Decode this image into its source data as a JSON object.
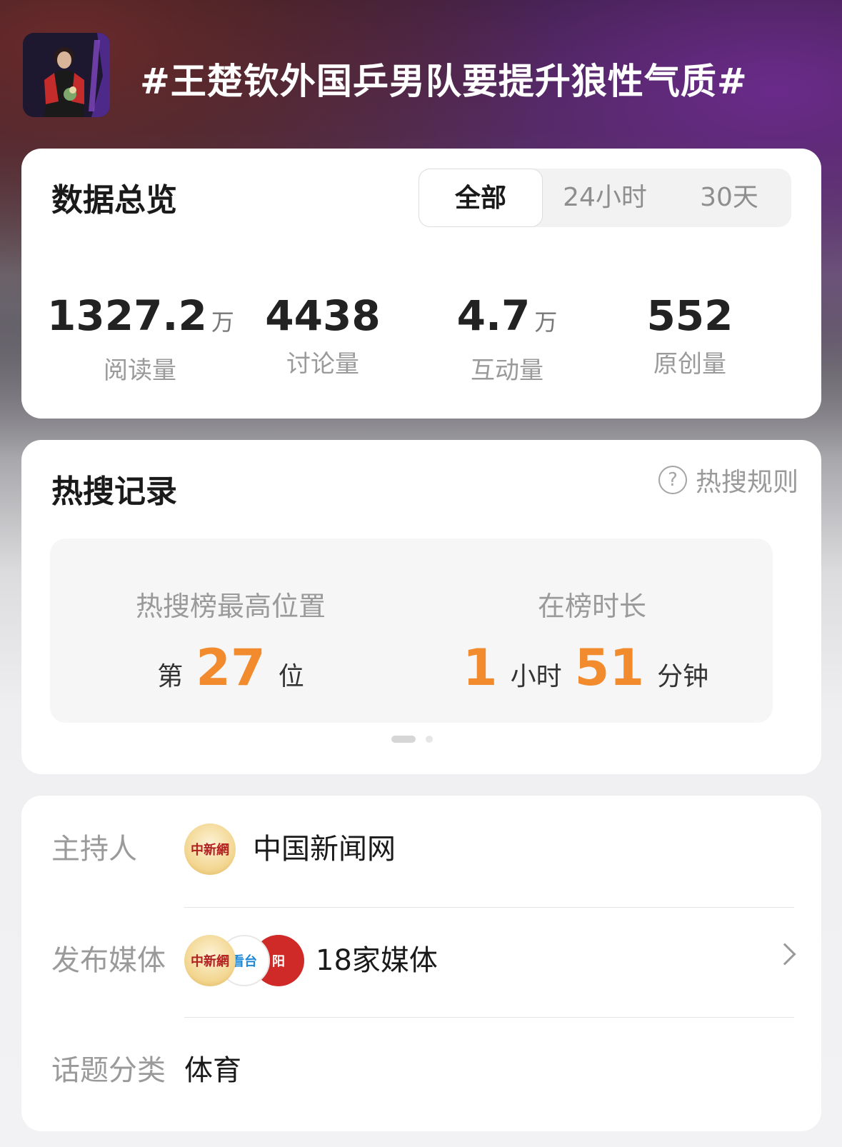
{
  "topic": {
    "title": "#王楚钦外国乒男队要提升狼性气质#"
  },
  "overview": {
    "title": "数据总览",
    "tabs": [
      "全部",
      "24小时",
      "30天"
    ],
    "active_tab": "全部",
    "stats": [
      {
        "value": "1327.2",
        "unit": "万",
        "label": "阅读量"
      },
      {
        "value": "4438",
        "unit": "",
        "label": "讨论量"
      },
      {
        "value": "4.7",
        "unit": "万",
        "label": "互动量"
      },
      {
        "value": "552",
        "unit": "",
        "label": "原创量"
      }
    ]
  },
  "hot_search": {
    "title": "热搜记录",
    "rules_label": "热搜规则",
    "highest": {
      "label": "热搜榜最高位置",
      "prefix": "第",
      "rank": "27",
      "suffix": "位"
    },
    "duration": {
      "label": "在榜时长",
      "hours": "1",
      "hours_unit": "小时",
      "minutes": "51",
      "minutes_unit": "分钟"
    },
    "pager": {
      "pages": 2,
      "current": 1
    }
  },
  "info": {
    "host": {
      "label": "主持人",
      "name": "中国新闻网",
      "logo_text": "中新網"
    },
    "media": {
      "label": "发布媒体",
      "count_text": "18家媒体",
      "logo_texts": [
        "中新網",
        "看台",
        "阳"
      ]
    },
    "category": {
      "label": "话题分类",
      "value": "体育"
    }
  },
  "colors": {
    "accent_orange": "#f28a2e"
  }
}
